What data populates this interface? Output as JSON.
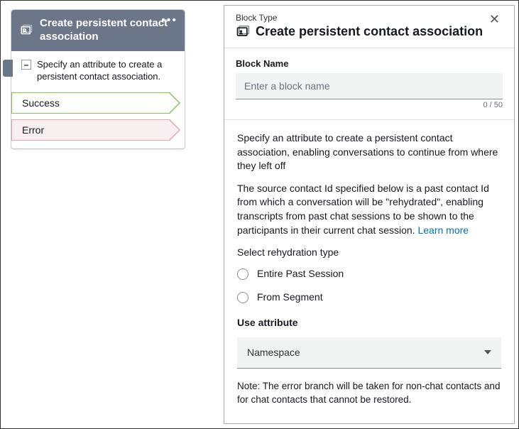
{
  "flow_block": {
    "title": "Create persistent contact association",
    "body": "Specify an attribute to create a persistent contact association.",
    "outputs": {
      "success": "Success",
      "error": "Error"
    }
  },
  "panel": {
    "subtitle": "Block Type",
    "title": "Create persistent contact association",
    "block_name_label": "Block Name",
    "block_name_placeholder": "Enter a block name",
    "block_name_value": "",
    "char_count": "0 / 50",
    "description_1": "Specify an attribute to create a persistent contact association, enabling conversations to continue from where they left off",
    "description_2": "The source contact Id specified below is a past contact Id from which a conversation will be \"rehydrated\", enabling transcripts from past chat sessions to be shown to the participants in their current chat session.",
    "learn_more_label": "Learn more",
    "rehydration_label": "Select rehydration type",
    "rehydration_options": {
      "entire": "Entire Past Session",
      "segment": "From Segment"
    },
    "use_attribute_label": "Use attribute",
    "namespace_select": "Namespace",
    "note": "Note: The error branch will be taken for non-chat contacts and for chat contacts that cannot be restored."
  }
}
